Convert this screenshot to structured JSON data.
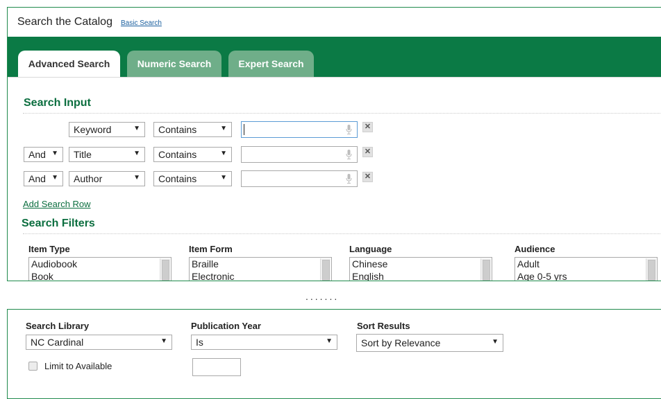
{
  "header": {
    "title": "Search the Catalog",
    "basic_search_link": "Basic Search"
  },
  "tabs": [
    {
      "label": "Advanced Search",
      "active": true
    },
    {
      "label": "Numeric Search",
      "active": false
    },
    {
      "label": "Expert Search",
      "active": false
    }
  ],
  "search_input": {
    "heading": "Search Input",
    "rows": [
      {
        "bool": "",
        "field": "Keyword",
        "op": "Contains",
        "value": ""
      },
      {
        "bool": "And",
        "field": "Title",
        "op": "Contains",
        "value": ""
      },
      {
        "bool": "And",
        "field": "Author",
        "op": "Contains",
        "value": ""
      }
    ],
    "remove_glyph": "✕",
    "add_row_link": "Add Search Row"
  },
  "filters": {
    "heading": "Search Filters",
    "item_type": {
      "label": "Item Type",
      "options": [
        "Audiobook",
        "Book"
      ]
    },
    "item_form": {
      "label": "Item Form",
      "options": [
        "Braille",
        "Electronic"
      ]
    },
    "language": {
      "label": "Language",
      "options": [
        "Chinese",
        "English"
      ]
    },
    "audience": {
      "label": "Audience",
      "options": [
        "Adult",
        "Age 0-5 yrs"
      ]
    }
  },
  "ellipsis": ".......",
  "bottom": {
    "library": {
      "label": "Search Library",
      "selected": "NC Cardinal"
    },
    "pub_year": {
      "label": "Publication Year",
      "selected": "Is",
      "year_value": ""
    },
    "sort": {
      "label": "Sort Results",
      "selected": "Sort by Relevance"
    },
    "limit_available": {
      "label": "Limit to Available",
      "checked": false
    }
  },
  "icons": {
    "dropdown": "▼",
    "mic": "microphone-icon",
    "remove": "close-icon"
  },
  "colors": {
    "brand_green": "#0b7a45",
    "tab_inactive": "#6fae89",
    "heading_green": "#0b6e3f"
  }
}
